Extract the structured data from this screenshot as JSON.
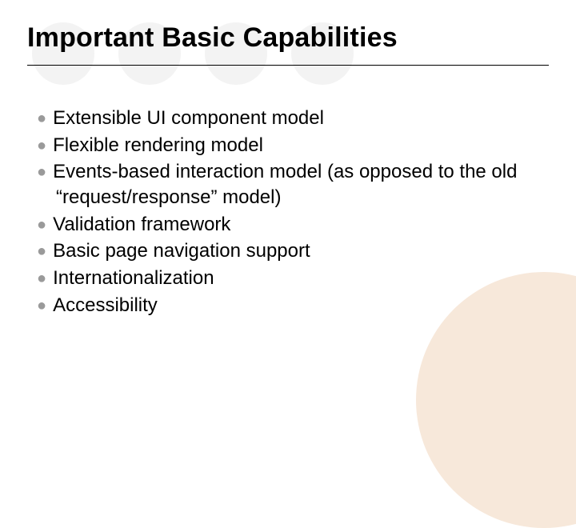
{
  "title": "Important Basic Capabilities",
  "bullets": [
    "Extensible UI component model",
    "Flexible rendering model",
    "Events-based interaction model (as opposed to the old “request/response” model)",
    "Validation framework",
    "Basic page navigation support",
    "Internationalization",
    "Accessibility"
  ]
}
